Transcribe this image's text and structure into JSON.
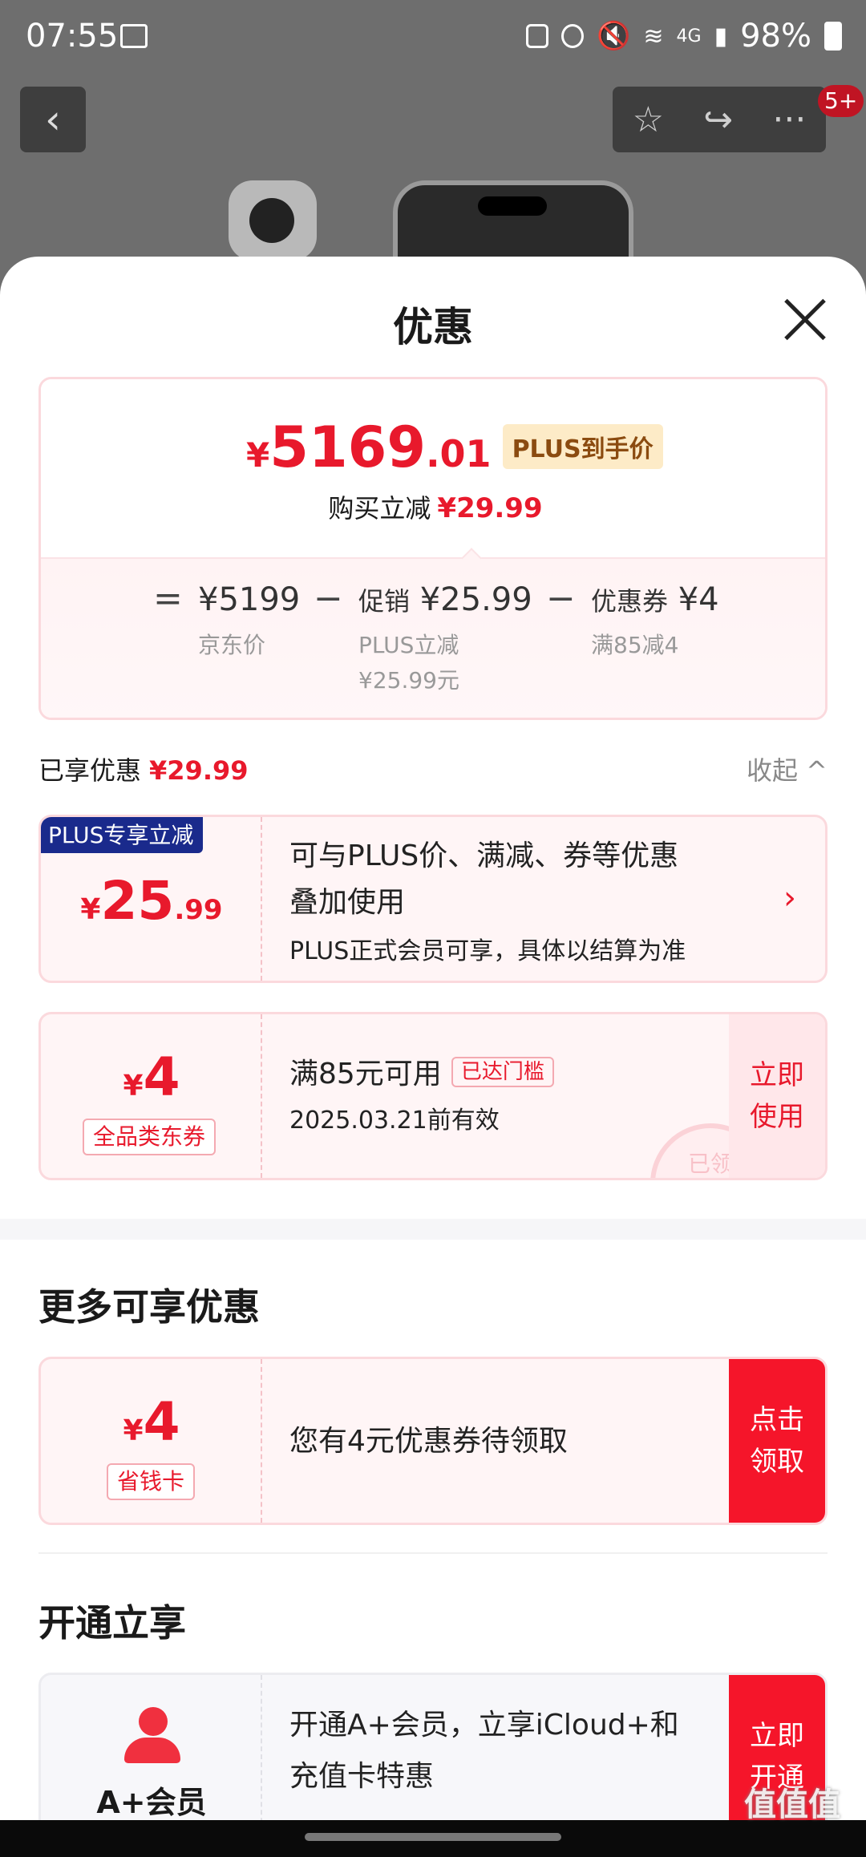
{
  "status_bar": {
    "time": "07:55",
    "network": "4G",
    "battery": "98%"
  },
  "top_nav": {
    "back": "‹",
    "star": "☆",
    "share": "↪",
    "more": "···",
    "badge": "5+"
  },
  "sheet": {
    "title": "优惠"
  },
  "price_summary": {
    "currency": "¥",
    "price_int": "5169",
    "price_dec": ".01",
    "plus_tag": "PLUS到手价",
    "cut_label": "购买立减",
    "cut_value": "¥29.99",
    "equals": "=",
    "minus": "−",
    "jd_price": "¥5199",
    "jd_label": "京东价",
    "promo_label": "促销",
    "promo_value": "¥25.99",
    "promo_sub1": "PLUS立减",
    "promo_sub2": "¥25.99元",
    "coupon_label": "优惠券",
    "coupon_value": "¥4",
    "coupon_sub": "满85减4"
  },
  "enjoyed": {
    "label": "已享优惠",
    "value": "¥29.99",
    "collapse": "收起 ^"
  },
  "plus_card": {
    "tag": "PLUS专享立减",
    "yen": "¥",
    "amount_int": "25",
    "amount_dec": ".99",
    "desc_line1": "可与PLUS价、满减、券等优惠",
    "desc_line2": "叠加使用",
    "note": "PLUS正式会员可享，具体以结算为准",
    "arrow": "›"
  },
  "coupon_card": {
    "yen": "¥",
    "amount": "4",
    "tag": "全品类东券",
    "condition": "满85元可用",
    "reached": "已达门槛",
    "valid": "2025.03.21前有效",
    "btn_l1": "立即",
    "btn_l2": "使用",
    "stamp": "已领"
  },
  "more": {
    "title": "更多可享优惠",
    "yen": "¥",
    "amount": "4",
    "tag": "省钱卡",
    "desc": "您有4元优惠券待领取",
    "btn_l1": "点击",
    "btn_l2": "领取"
  },
  "open": {
    "title": "开通立享",
    "name": "A+会员",
    "desc_line1": "开通A+会员，立享iCloud+和",
    "desc_line2": "充值卡特惠",
    "btn_l1": "立即",
    "btn_l2": "开通"
  },
  "watermark": "值值值"
}
